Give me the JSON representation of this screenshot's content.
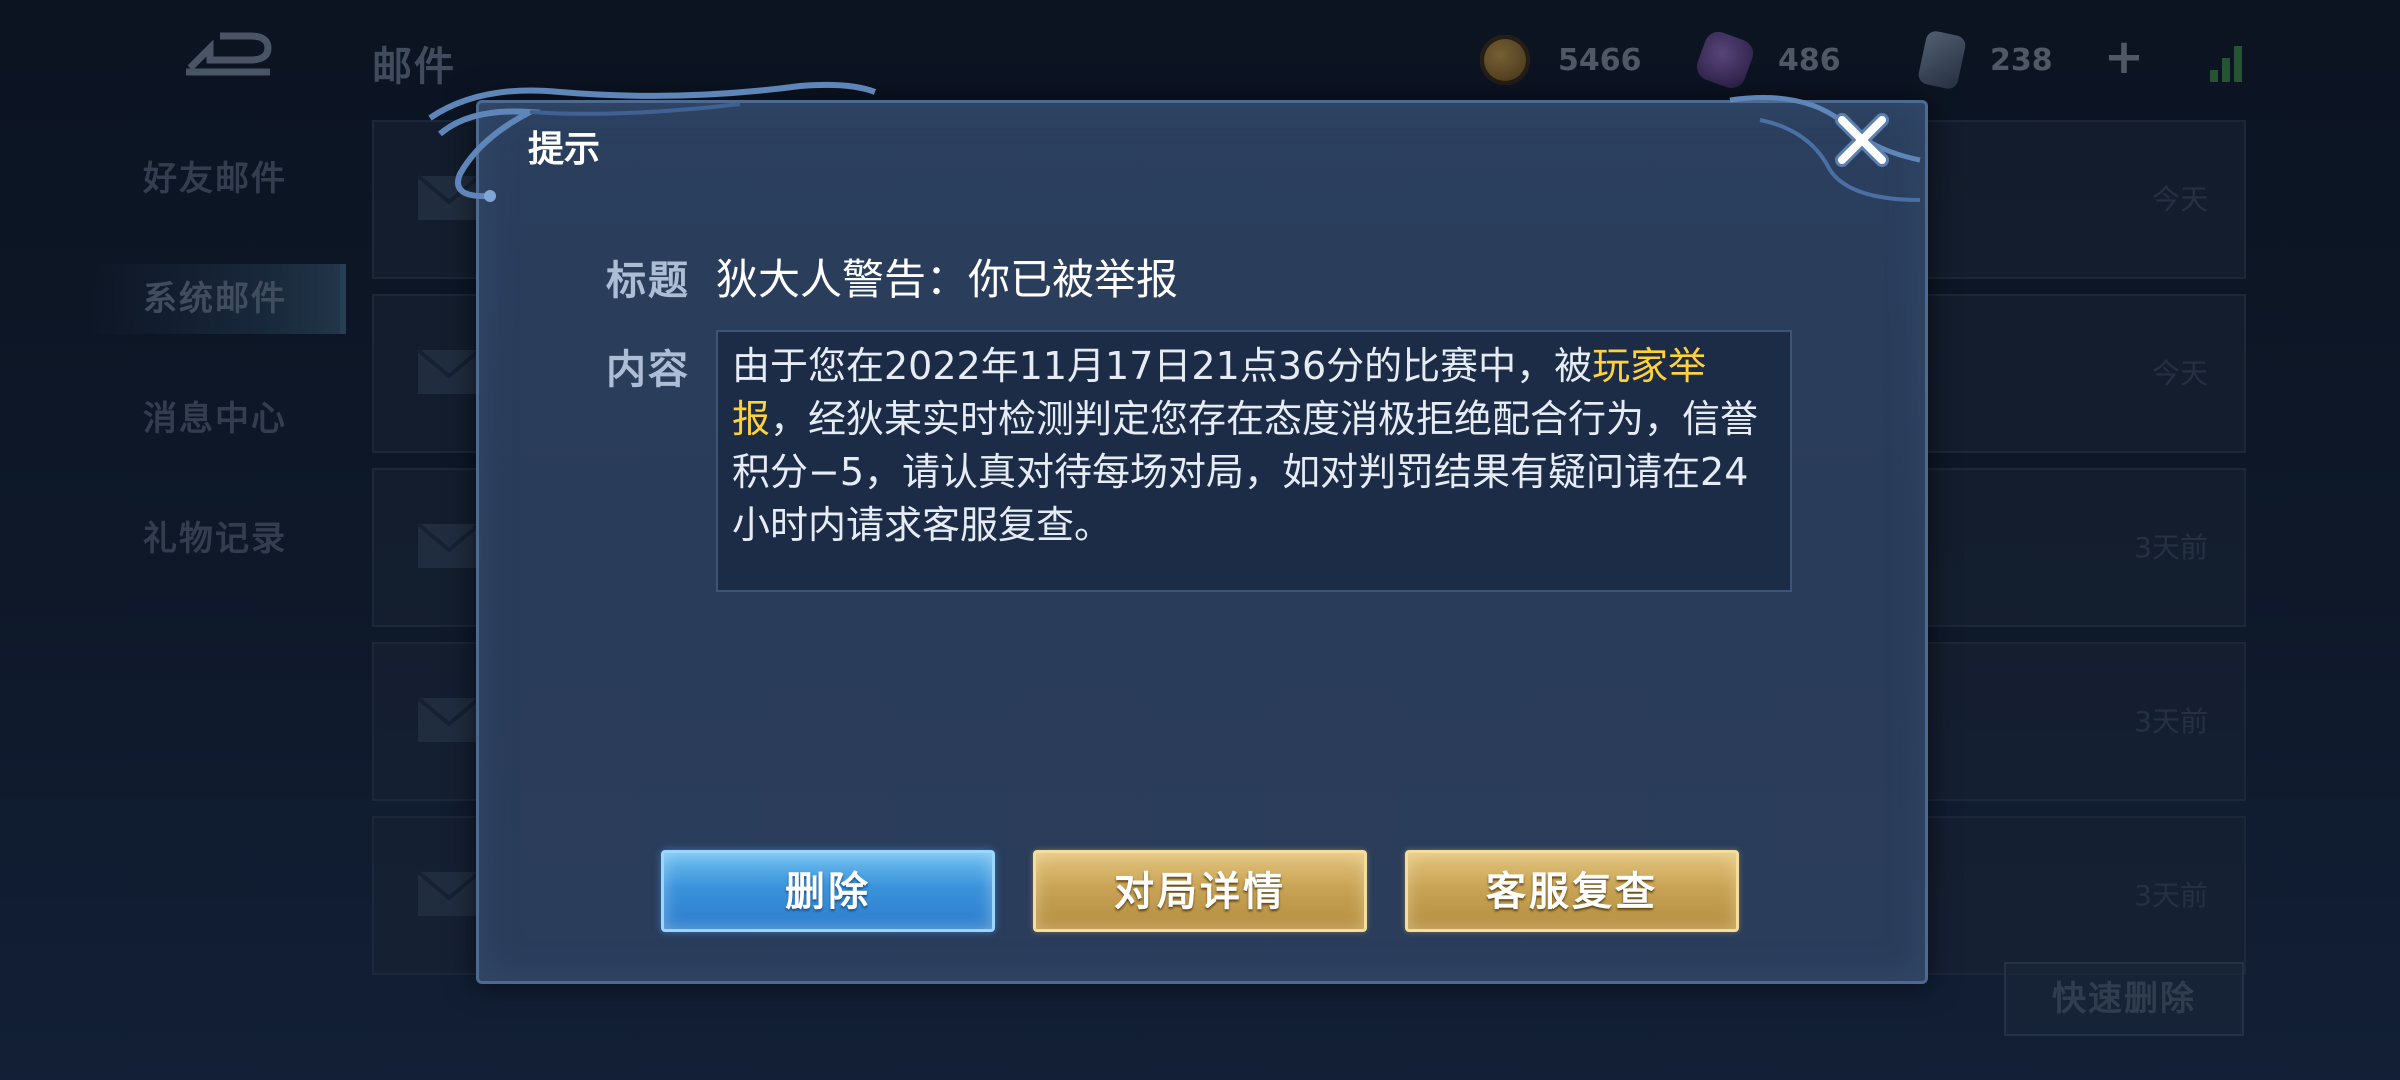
{
  "header": {
    "title": "邮件",
    "currencies": {
      "gold": "5466",
      "gem": "486",
      "coupon": "238"
    }
  },
  "sidebar": {
    "items": [
      {
        "label": "好友邮件"
      },
      {
        "label": "系统邮件"
      },
      {
        "label": "消息中心"
      },
      {
        "label": "礼物记录"
      }
    ]
  },
  "mail_list": {
    "rows": [
      {
        "time": "今天"
      },
      {
        "time": "今天"
      },
      {
        "time": "3天前"
      },
      {
        "time": "3天前"
      },
      {
        "time": "3天前"
      }
    ],
    "quick_delete_label": "快速删除"
  },
  "dialog": {
    "title": "提示",
    "subject_label": "标题",
    "subject": "狄大人警告：你已被举报",
    "content_label": "内容",
    "content_part1": "由于您在2022年11月17日21点36分的比赛中，被",
    "content_highlight": "玩家举报",
    "content_part2": "，经狄某实时检测判定您存在态度消极拒绝配合行为，信誉积分−5，请认真对待每场对局，如对判罚结果有疑问请在24小时内请求客服复查。",
    "highlight_color": "#ffd23b",
    "buttons": {
      "delete": "删除",
      "match_detail": "对局详情",
      "customer_service": "客服复查"
    }
  }
}
